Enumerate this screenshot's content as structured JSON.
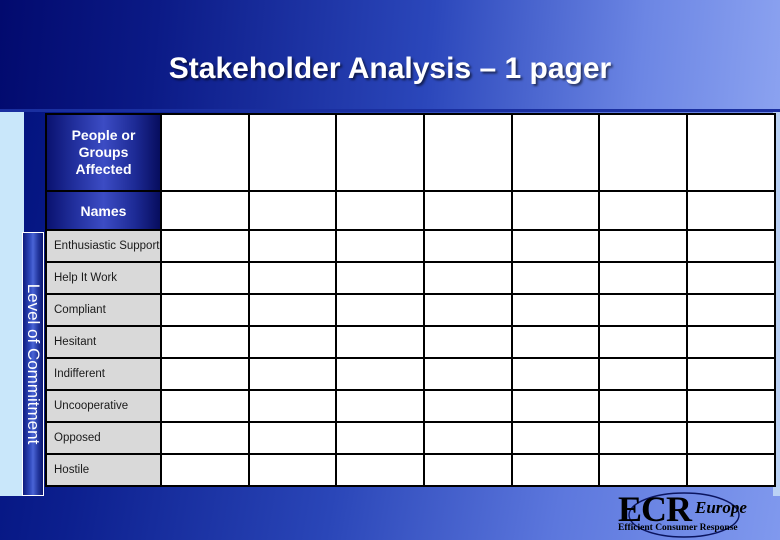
{
  "slide": {
    "title": "Stakeholder Analysis – 1 pager",
    "background_left_color": "#000f7a",
    "background_right_color": "#8099ee",
    "accent_pale_color": "#c9e7fa"
  },
  "table": {
    "corner_header": "People or Groups Affected",
    "corner_header_lines": [
      "People or",
      "Groups",
      "Affected"
    ],
    "names_header": "Names",
    "axis_label": "Level of Commitment",
    "row_labels": [
      "Enthusiastic Support",
      "Help It Work",
      "Compliant",
      "Hesitant",
      "Indifferent",
      "Uncooperative",
      "Opposed",
      "Hostile"
    ],
    "data_column_count": 7,
    "cells": [
      [
        "",
        "",
        "",
        "",
        "",
        "",
        ""
      ],
      [
        "",
        "",
        "",
        "",
        "",
        "",
        ""
      ],
      [
        "",
        "",
        "",
        "",
        "",
        "",
        ""
      ],
      [
        "",
        "",
        "",
        "",
        "",
        "",
        ""
      ],
      [
        "",
        "",
        "",
        "",
        "",
        "",
        ""
      ],
      [
        "",
        "",
        "",
        "",
        "",
        "",
        ""
      ],
      [
        "",
        "",
        "",
        "",
        "",
        "",
        ""
      ],
      [
        "",
        "",
        "",
        "",
        "",
        "",
        ""
      ]
    ],
    "header_row_cells": [
      "",
      "",
      "",
      "",
      "",
      "",
      ""
    ],
    "names_row_cells": [
      "",
      "",
      "",
      "",
      "",
      "",
      ""
    ]
  },
  "logo": {
    "mark": "ECR",
    "region": "Europe",
    "tagline": "Efficient Consumer Response"
  }
}
